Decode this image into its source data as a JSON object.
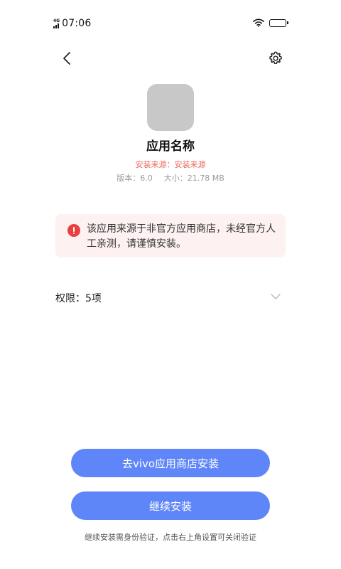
{
  "status_bar": {
    "network_label": "4G",
    "time": "07:06"
  },
  "header": {
    "back_icon": "chevron-left-icon",
    "settings_icon": "gear-icon"
  },
  "app": {
    "name": "应用名称",
    "source": "安装来源：安装来源",
    "version": "版本：6.0",
    "size": "大小：21.78 MB"
  },
  "warning": {
    "icon": "alert-icon",
    "color": "#ea3f3f",
    "text": "该应用来源于非官方应用商店，未经官方人工亲测，请谨慎安装。"
  },
  "permissions": {
    "label": "权限：5项"
  },
  "actions": {
    "store_install": "去vivo应用商店安装",
    "continue_install": "继续安装",
    "button_color": "#5f86f9"
  },
  "footnote": "继续安装需身份验证，点击右上角设置可关闭验证"
}
